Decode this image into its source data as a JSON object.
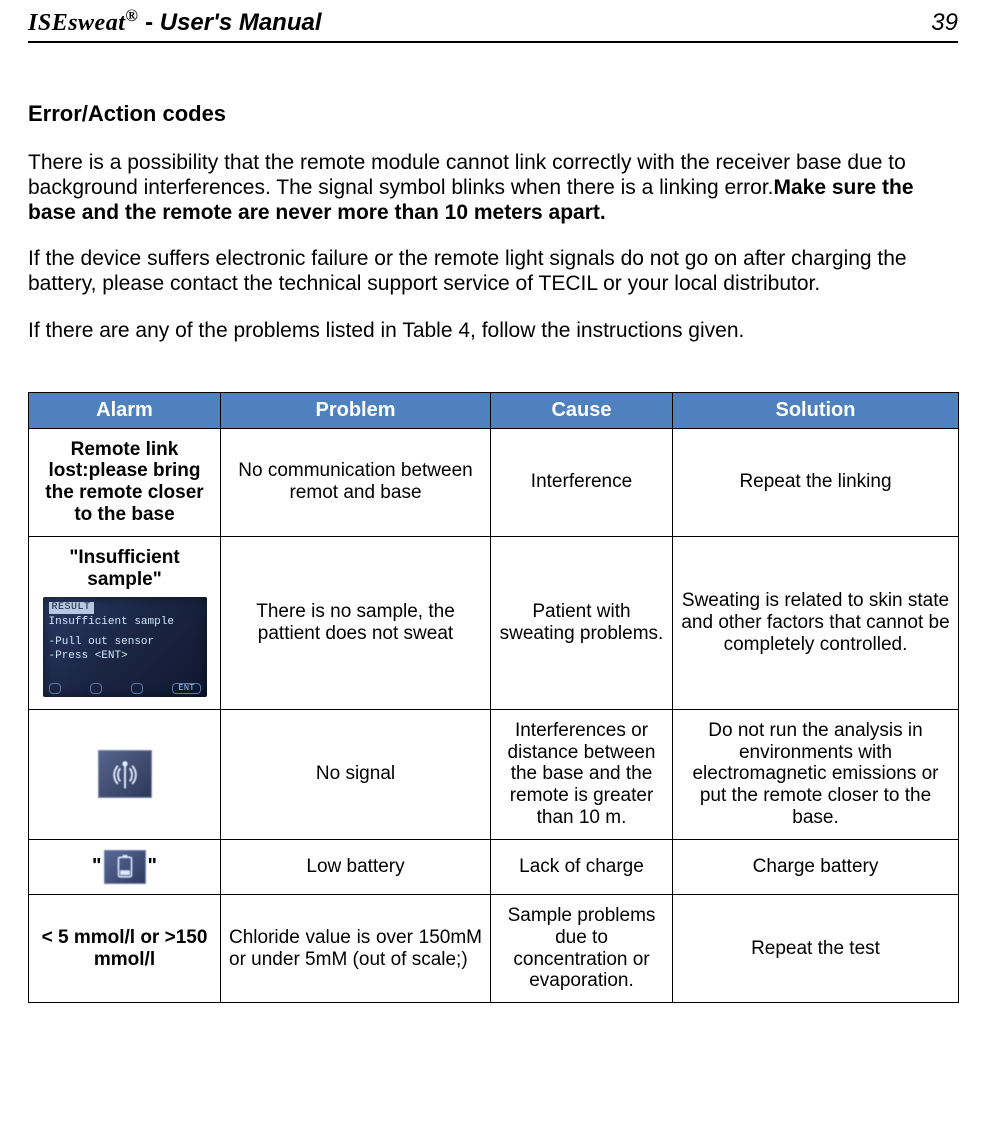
{
  "header": {
    "brand": "ISEsweat",
    "reg": "®",
    "dash": " -  ",
    "title_rest": "User's  Manual",
    "page_number": "39"
  },
  "section": {
    "heading": "Error/Action codes",
    "para1_a": "There is a possibility that the remote module cannot link correctly with the receiver base due to background interferences. The signal symbol blinks when there is a linking error.",
    "para1_b": "Make sure the base and the remote are never more than 10 meters apart.",
    "para2": "If the device suffers  electronic failure or the remote light signals do not go on after charging the battery, please contact the technical support service of TECIL or your local distributor.",
    "para3": "If there are any of the problems listed in Table 4,  follow the instructions given."
  },
  "table": {
    "headers": {
      "alarm": "Alarm",
      "problem": "Problem",
      "cause": "Cause",
      "solution": "Solution"
    },
    "rows": [
      {
        "alarm": "Remote link lost:please bring the remote closer to the base",
        "problem": "No communication between remot and base",
        "cause": "Interference",
        "solution": "Repeat the linking"
      },
      {
        "alarm": "\"Insufficient sample\"",
        "lcd": {
          "tag": "RESULT",
          "l1": "Insufficient sample",
          "l2": "-Pull out sensor",
          "l3": "-Press <ENT>",
          "sk4": "ENT"
        },
        "problem": "There is no sample, the pattient does not sweat",
        "cause": "Patient with sweating problems.",
        "solution": "Sweating is related to skin state and other factors that cannot be completely controlled."
      },
      {
        "alarm_icon": "antenna",
        "problem": "No signal",
        "cause": "Interferences or distance between the base and the remote is greater than 10 m.",
        "solution": "Do not run the analysis in environments with electromagnetic emissions or put the remote closer to the base."
      },
      {
        "alarm_icon": "battery",
        "alarm_ql": "\"",
        "alarm_qr": "\"",
        "problem": "Low battery",
        "cause": "Lack of charge",
        "solution": "Charge battery"
      },
      {
        "alarm": "< 5 mmol/l or >150 mmol/l",
        "problem": "Chloride value is over 150mM or under 5mM (out of scale;)",
        "cause": "Sample problems due to concentration or evaporation.",
        "solution": "Repeat the test"
      }
    ]
  }
}
